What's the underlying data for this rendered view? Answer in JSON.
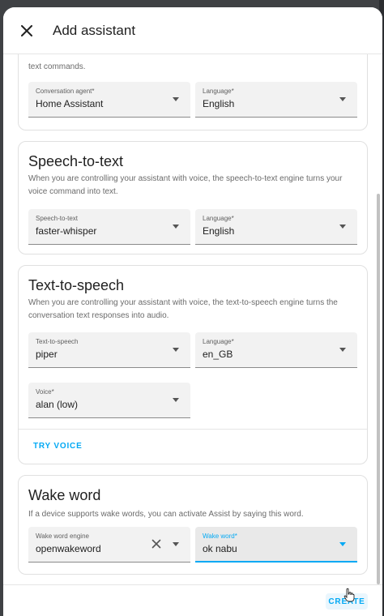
{
  "dialog": {
    "title": "Add assistant",
    "close_icon": "close-icon"
  },
  "conversation": {
    "desc_tail": "text commands.",
    "agent_label": "Conversation agent*",
    "agent_value": "Home Assistant",
    "language_label": "Language*",
    "language_value": "English"
  },
  "stt": {
    "title": "Speech-to-text",
    "desc": "When you are controlling your assistant with voice, the speech-to-text engine turns your voice command into text.",
    "engine_label": "Speech-to-text",
    "engine_value": "faster-whisper",
    "language_label": "Language*",
    "language_value": "English"
  },
  "tts": {
    "title": "Text-to-speech",
    "desc": "When you are controlling your assistant with voice, the text-to-speech engine turns the conversation text responses into audio.",
    "engine_label": "Text-to-speech",
    "engine_value": "piper",
    "language_label": "Language*",
    "language_value": "en_GB",
    "voice_label": "Voice*",
    "voice_value": "alan (low)",
    "try_voice": "TRY VOICE"
  },
  "wake": {
    "title": "Wake word",
    "desc": "If a device supports wake words, you can activate Assist by saying this word.",
    "engine_label": "Wake word engine",
    "engine_value": "openwakeword",
    "word_label": "Wake word*",
    "word_value": "ok nabu"
  },
  "footer": {
    "create_label": "CREATE"
  },
  "colors": {
    "accent": "#03a9f4",
    "backdrop": "#3f4144"
  }
}
